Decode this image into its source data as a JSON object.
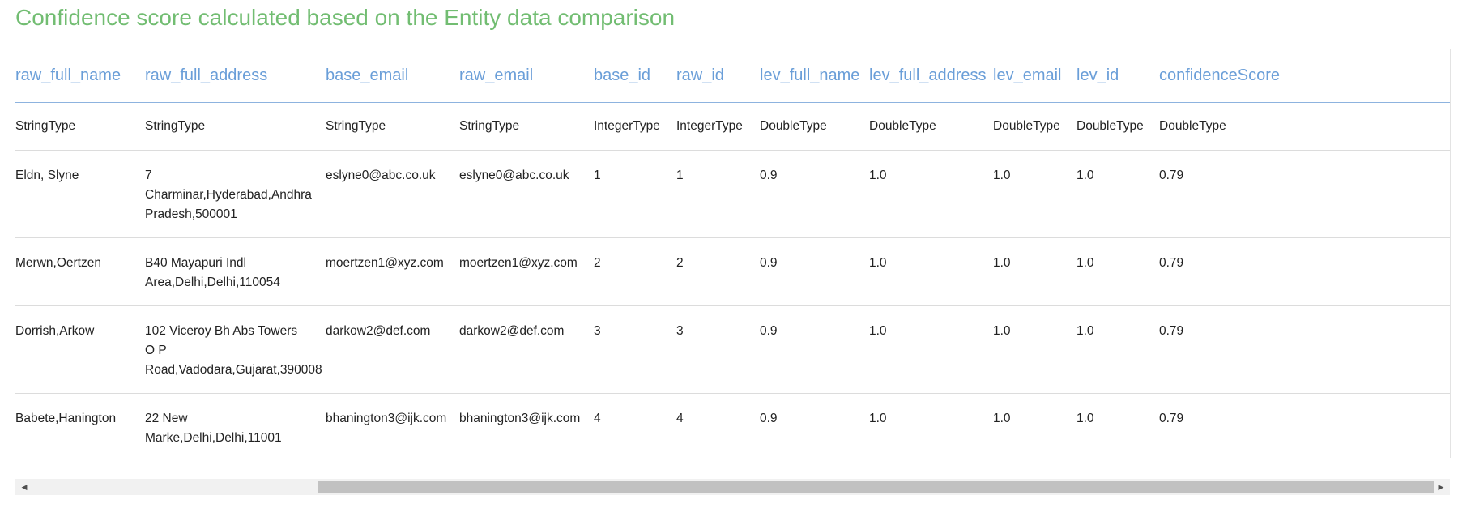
{
  "page": {
    "title": "Confidence score calculated based on the Entity data comparison"
  },
  "table": {
    "columns": [
      {
        "name": "raw_full_name",
        "type": "StringType"
      },
      {
        "name": "raw_full_address",
        "type": "StringType"
      },
      {
        "name": "base_email",
        "type": "StringType"
      },
      {
        "name": "raw_email",
        "type": "StringType"
      },
      {
        "name": "base_id",
        "type": "IntegerType"
      },
      {
        "name": "raw_id",
        "type": "IntegerType"
      },
      {
        "name": "lev_full_name",
        "type": "DoubleType"
      },
      {
        "name": "lev_full_address",
        "type": "DoubleType"
      },
      {
        "name": "lev_email",
        "type": "DoubleType"
      },
      {
        "name": "lev_id",
        "type": "DoubleType"
      },
      {
        "name": "confidenceScore",
        "type": "DoubleType"
      }
    ],
    "rows": [
      [
        "Eldn, Slyne",
        "7 Charminar,Hyderabad,Andhra Pradesh,500001",
        "eslyne0@abc.co.uk",
        "eslyne0@abc.co.uk",
        "1",
        "1",
        "0.9",
        "1.0",
        "1.0",
        "1.0",
        "0.79"
      ],
      [
        "Merwn,Oertzen",
        "B40 Mayapuri Indl Area,Delhi,Delhi,110054",
        "moertzen1@xyz.com",
        "moertzen1@xyz.com",
        "2",
        "2",
        "0.9",
        "1.0",
        "1.0",
        "1.0",
        "0.79"
      ],
      [
        "Dorrish,Arkow",
        "102 Viceroy Bh Abs Towers O P Road,Vadodara,Gujarat,390008",
        "darkow2@def.com",
        "darkow2@def.com",
        "3",
        "3",
        "0.9",
        "1.0",
        "1.0",
        "1.0",
        "0.79"
      ],
      [
        "Babete,Hanington",
        "22 New Marke,Delhi,Delhi,11001",
        "bhanington3@ijk.com",
        "bhanington3@ijk.com",
        "4",
        "4",
        "0.9",
        "1.0",
        "1.0",
        "1.0",
        "0.79"
      ]
    ]
  },
  "scrollbar": {
    "left_arrow": "◀",
    "right_arrow": "▶",
    "position_fraction": 0.21
  }
}
